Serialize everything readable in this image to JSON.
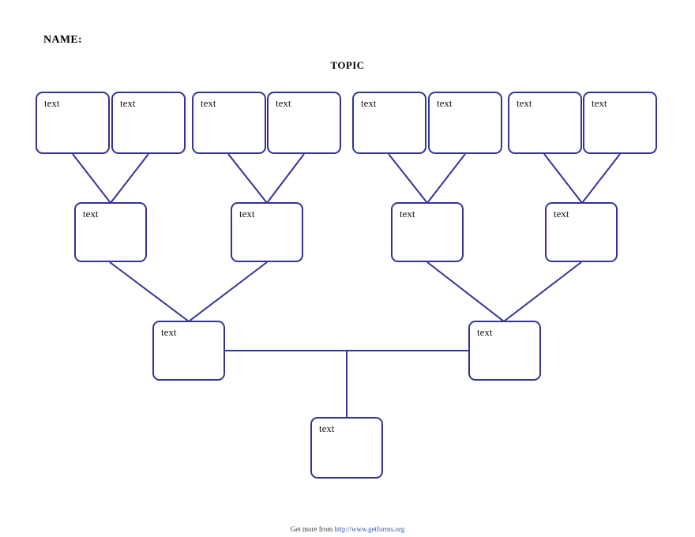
{
  "document": {
    "name_label": "NAME:",
    "topic_label": "TOPIC"
  },
  "colors": {
    "box_border": "#333399",
    "connector": "#333399",
    "text": "#111111",
    "link": "#3355bb",
    "background": "#ffffff"
  },
  "tree": {
    "generation_1": [
      {
        "id": "g1-1",
        "label": "text"
      },
      {
        "id": "g1-2",
        "label": "text"
      },
      {
        "id": "g1-3",
        "label": "text"
      },
      {
        "id": "g1-4",
        "label": "text"
      },
      {
        "id": "g1-5",
        "label": "text"
      },
      {
        "id": "g1-6",
        "label": "text"
      },
      {
        "id": "g1-7",
        "label": "text"
      },
      {
        "id": "g1-8",
        "label": "text"
      }
    ],
    "generation_2": [
      {
        "id": "g2-1",
        "label": "text"
      },
      {
        "id": "g2-2",
        "label": "text"
      },
      {
        "id": "g2-3",
        "label": "text"
      },
      {
        "id": "g2-4",
        "label": "text"
      }
    ],
    "generation_3": [
      {
        "id": "g3-1",
        "label": "text"
      },
      {
        "id": "g3-2",
        "label": "text"
      }
    ],
    "generation_4": [
      {
        "id": "g4-1",
        "label": "text"
      }
    ]
  },
  "footer": {
    "prefix": "Get more from ",
    "link": "http://www.getforms.org"
  }
}
